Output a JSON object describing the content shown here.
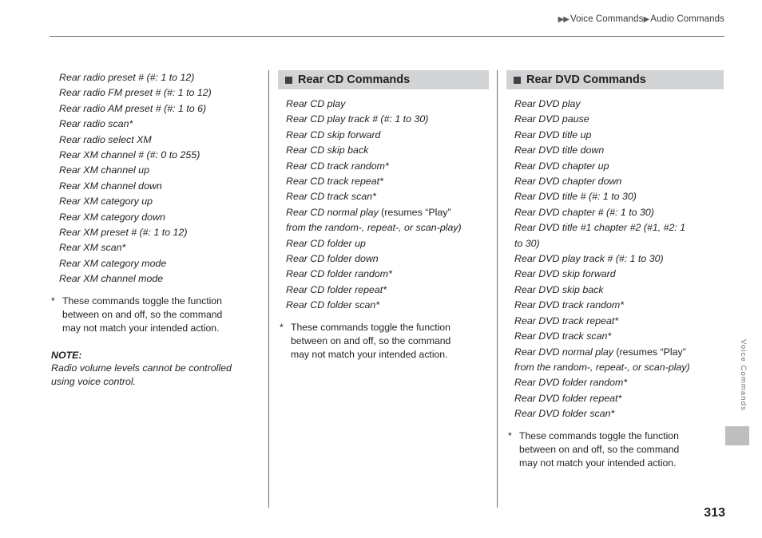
{
  "header": {
    "breadcrumb_arrow": "▶▶",
    "crumb_1": "Voice Commands",
    "crumb_sep": "▶",
    "crumb_2": "Audio Commands"
  },
  "side_tab": "Voice Commands",
  "page_number": "313",
  "col1": {
    "commands": [
      "Rear radio preset # (#: 1 to 12)",
      "Rear radio FM preset # (#: 1 to 12)",
      "Rear radio AM preset # (#: 1 to 6)",
      "Rear radio scan*",
      "Rear radio select XM",
      "Rear XM channel # (#: 0 to 255)",
      "Rear XM channel up",
      "Rear XM channel down",
      "Rear XM category up",
      "Rear XM category down",
      "Rear XM preset # (#: 1 to 12)",
      "Rear XM scan*",
      "Rear XM category mode",
      "Rear XM channel mode"
    ],
    "footnote_star": "*",
    "footnote_line1": "These commands toggle the function",
    "footnote_line2": "between on and off, so the command",
    "footnote_line3": "may not match your intended action.",
    "note_title": "NOTE:",
    "note_line1": "Radio volume levels cannot be controlled",
    "note_line2": "using voice control."
  },
  "col2": {
    "heading": "Rear CD Commands",
    "commands": [
      {
        "text": "Rear CD play"
      },
      {
        "text": "Rear CD play track # (#: 1 to 30)"
      },
      {
        "text": "Rear CD skip forward"
      },
      {
        "text": "Rear CD skip back"
      },
      {
        "text": "Rear CD track random*"
      },
      {
        "text": "Rear CD track repeat*"
      },
      {
        "text": "Rear CD track scan*"
      },
      {
        "text": "Rear CD normal play",
        "suffix": " (resumes “Play”"
      },
      {
        "text": "from the random-, repeat-, or scan-play)",
        "continuation": true
      },
      {
        "text": "Rear CD folder up"
      },
      {
        "text": "Rear CD folder down"
      },
      {
        "text": "Rear CD folder random*"
      },
      {
        "text": "Rear CD folder repeat*"
      },
      {
        "text": "Rear CD folder scan*"
      }
    ],
    "footnote_star": "*",
    "footnote_line1": "These commands toggle the function",
    "footnote_line2": "between on and off, so the command",
    "footnote_line3": "may not match your intended action."
  },
  "col3": {
    "heading": "Rear DVD Commands",
    "commands": [
      {
        "text": "Rear DVD play"
      },
      {
        "text": "Rear DVD pause"
      },
      {
        "text": "Rear DVD title up"
      },
      {
        "text": "Rear DVD title down"
      },
      {
        "text": "Rear DVD chapter up"
      },
      {
        "text": "Rear DVD chapter down"
      },
      {
        "text": "Rear DVD title # (#: 1 to 30)"
      },
      {
        "text": "Rear DVD chapter # (#: 1 to 30)"
      },
      {
        "text": "Rear DVD title #1 chapter #2 (#1, #2: 1"
      },
      {
        "text": "to 30)",
        "continuation": true
      },
      {
        "text": "Rear DVD play track # (#: 1 to 30)"
      },
      {
        "text": "Rear DVD skip forward"
      },
      {
        "text": "Rear DVD skip back"
      },
      {
        "text": "Rear DVD track random*"
      },
      {
        "text": "Rear DVD track repeat*"
      },
      {
        "text": "Rear DVD track scan*"
      },
      {
        "text": "Rear DVD normal play",
        "suffix": " (resumes “Play”"
      },
      {
        "text": "from the random-, repeat-, or scan-play)",
        "continuation": true
      },
      {
        "text": "Rear DVD folder random*"
      },
      {
        "text": "Rear DVD folder repeat*"
      },
      {
        "text": "Rear DVD folder scan*"
      }
    ],
    "footnote_star": "*",
    "footnote_line1": "These commands toggle the function",
    "footnote_line2": "between on and off, so the command",
    "footnote_line3": "may not match your intended action."
  }
}
